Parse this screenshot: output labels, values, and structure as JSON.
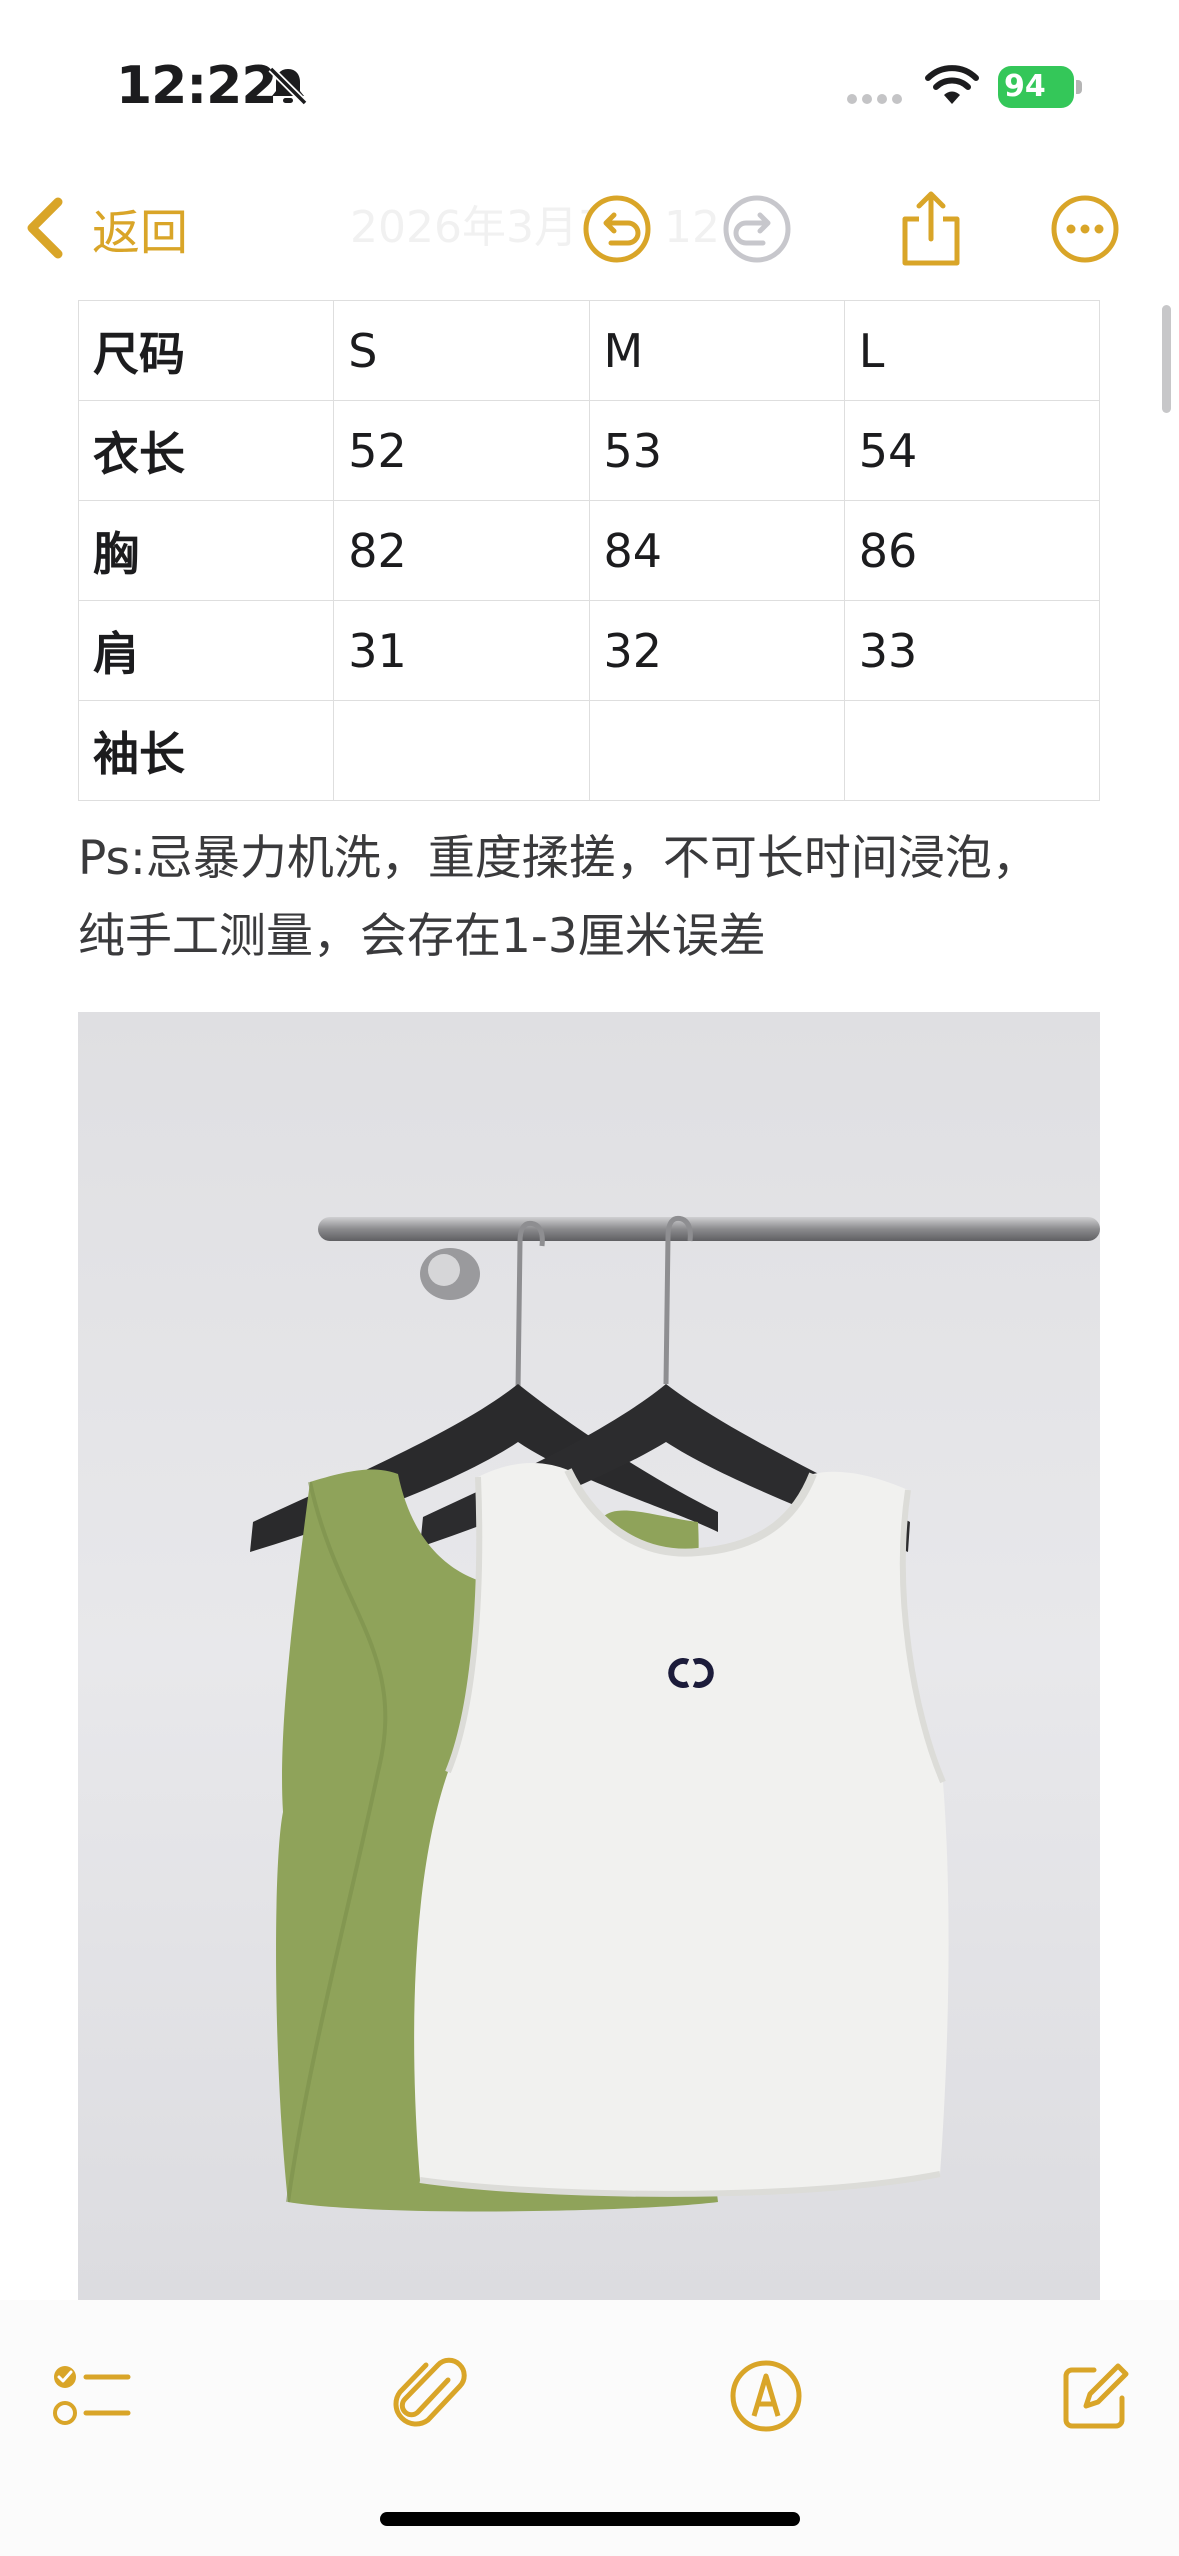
{
  "status_bar": {
    "time": "12:22",
    "battery_percent": "94"
  },
  "nav": {
    "back_label": "返回",
    "faded_title": "2026年3月7日 12:22"
  },
  "size_table": {
    "rows": [
      [
        "尺码",
        "S",
        "M",
        "L"
      ],
      [
        "衣长",
        "52",
        "53",
        "54"
      ],
      [
        "胸",
        "82",
        "84",
        "86"
      ],
      [
        "肩",
        "31",
        "32",
        "33"
      ],
      [
        "袖长",
        "",
        "",
        ""
      ]
    ]
  },
  "note": {
    "line1": "Ps:忌暴力机洗，重度揉搓，不可长时间浸泡，",
    "line2": "纯手工测量，会存在1-3厘米误差"
  },
  "colors": {
    "accent": "#d9a528",
    "table_border": "#dedede",
    "battery_green": "#34c759",
    "photo_wall": "#e6e6e9",
    "green_top": "#8fa35a"
  },
  "icons": [
    "bell-slash-icon",
    "cellular-icon",
    "wifi-icon",
    "battery-icon",
    "chevron-left-icon",
    "undo-icon",
    "redo-icon",
    "share-icon",
    "more-icon",
    "checklist-icon",
    "attachment-icon",
    "markup-icon",
    "compose-icon"
  ]
}
